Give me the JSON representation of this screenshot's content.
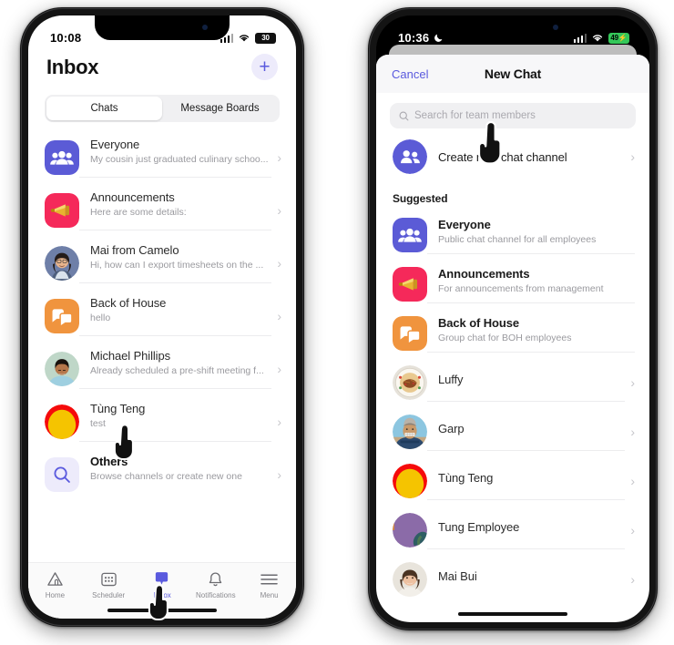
{
  "accent": "#5A5ADE",
  "left_phone": {
    "status": {
      "time": "10:08",
      "battery": "30",
      "signal_icon": "cellular-signal-icon",
      "wifi_icon": "wifi-icon",
      "battery_icon": "battery-icon"
    },
    "header": {
      "title": "Inbox",
      "add_label": "+"
    },
    "tabs": [
      {
        "label": "Chats",
        "active": true
      },
      {
        "label": "Message Boards",
        "active": false
      }
    ],
    "chats": [
      {
        "name": "Everyone",
        "preview": "My cousin just graduated culinary schoo...",
        "avatar": "group-icon"
      },
      {
        "name": "Announcements",
        "preview": "Here are some details:",
        "avatar": "megaphone-icon"
      },
      {
        "name": "Mai from Camelo",
        "preview": "Hi, how can I export timesheets on the ...",
        "avatar": "photo-mai"
      },
      {
        "name": "Back of House",
        "preview": "hello",
        "avatar": "chat-bubbles-icon"
      },
      {
        "name": "Michael Phillips",
        "preview": "Already scheduled a pre-shift meeting f...",
        "avatar": "photo-michael"
      },
      {
        "name": "Tùng Teng",
        "preview": "test",
        "avatar": "photo-tung"
      },
      {
        "name": "Others",
        "preview": "Browse channels or create new one",
        "avatar": "search-icon"
      }
    ],
    "tabbar": [
      {
        "label": "Home",
        "icon": "home-icon",
        "active": false
      },
      {
        "label": "Scheduler",
        "icon": "calendar-icon",
        "active": false
      },
      {
        "label": "Inbox",
        "icon": "inbox-icon",
        "active": true
      },
      {
        "label": "Notifications",
        "icon": "bell-icon",
        "active": false
      },
      {
        "label": "Menu",
        "icon": "hamburger-menu-icon",
        "active": false
      }
    ]
  },
  "right_phone": {
    "status": {
      "time": "10:36",
      "battery": "49",
      "dnd_icon": "moon-icon",
      "signal_icon": "cellular-signal-icon",
      "wifi_icon": "wifi-icon",
      "battery_icon": "battery-charging-icon"
    },
    "sheet": {
      "cancel_label": "Cancel",
      "title": "New Chat",
      "search_placeholder": "Search for team members",
      "search_value": "",
      "create_label": "Create new chat channel",
      "section_label": "Suggested"
    },
    "suggested": [
      {
        "name": "Everyone",
        "desc": "Public chat channel for all employees",
        "avatar": "group-icon"
      },
      {
        "name": "Announcements",
        "desc": "For announcements from management",
        "avatar": "megaphone-icon"
      },
      {
        "name": "Back of House",
        "desc": "Group chat for BOH employees",
        "avatar": "chat-bubbles-icon"
      },
      {
        "name": "Luffy",
        "desc": "",
        "avatar": "photo-luffy"
      },
      {
        "name": "Garp",
        "desc": "",
        "avatar": "photo-garp"
      },
      {
        "name": "Tùng Teng",
        "desc": "",
        "avatar": "photo-tung"
      },
      {
        "name": "Tung Employee",
        "desc": "",
        "avatar": "photo-tung-employee"
      },
      {
        "name": "Mai Bui",
        "desc": "",
        "avatar": "photo-mai-bui"
      }
    ]
  }
}
